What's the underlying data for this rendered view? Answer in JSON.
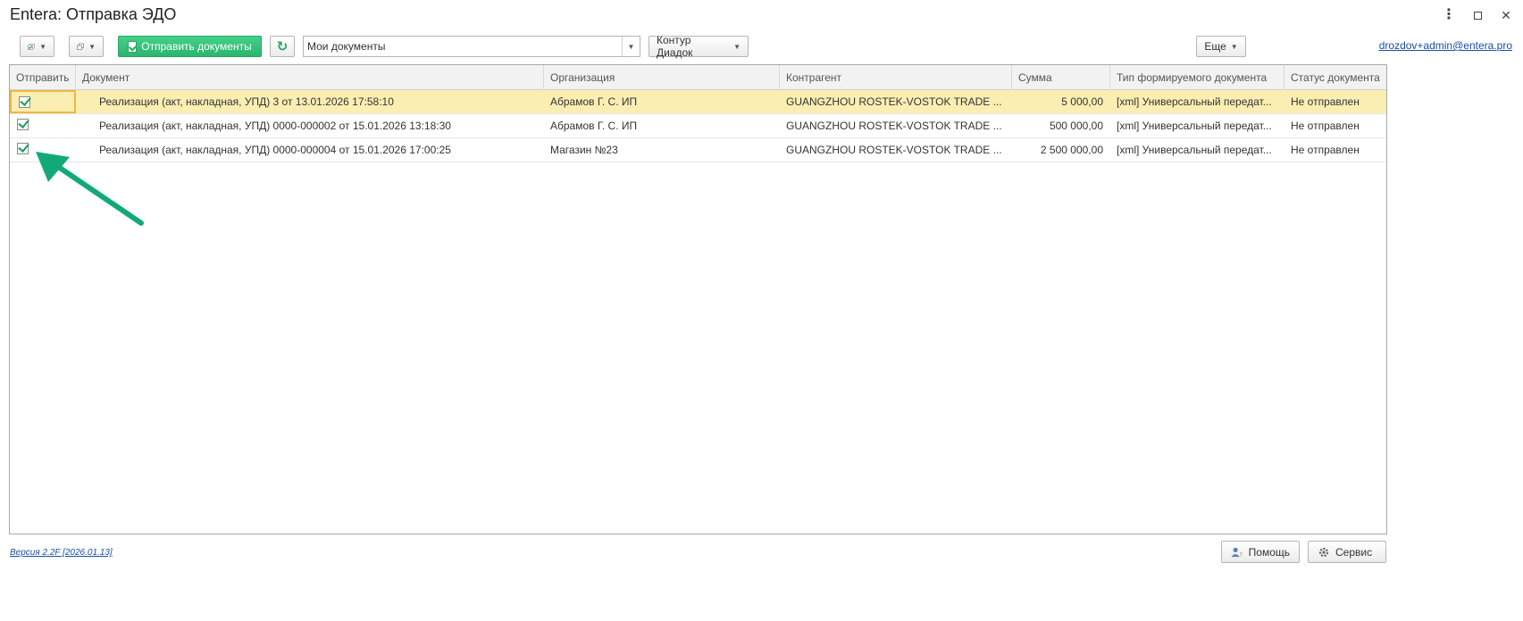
{
  "window": {
    "title": "Entera: Отправка ЭДО"
  },
  "toolbar": {
    "send_label": "Отправить документы",
    "filter_value": "Мои документы",
    "provider_label": "Контур Диадок",
    "more_label": "Еще",
    "user_email": "drozdov+admin@entera.pro"
  },
  "table": {
    "columns": [
      "Отправить",
      "Документ",
      "Организация",
      "Контрагент",
      "Сумма",
      "Тип формируемого документа",
      "Статус документа"
    ],
    "rows": [
      {
        "document": "Реализация (акт, накладная, УПД) 3 от 13.01.2026 17:58:10",
        "organization": "Абрамов Г. С. ИП",
        "counterparty": "GUANGZHOU ROSTEK-VOSTOK TRADE ...",
        "sum": "5 000,00",
        "type": "[xml] Универсальный передат...",
        "status": "Не отправлен"
      },
      {
        "document": "Реализация (акт, накладная, УПД) 0000-000002 от 15.01.2026 13:18:30",
        "organization": "Абрамов Г. С. ИП",
        "counterparty": "GUANGZHOU ROSTEK-VOSTOK TRADE ...",
        "sum": "500 000,00",
        "type": "[xml] Универсальный передат...",
        "status": "Не отправлен"
      },
      {
        "document": "Реализация (акт, накладная, УПД) 0000-000004 от 15.01.2026 17:00:25",
        "organization": "Магазин №23",
        "counterparty": "GUANGZHOU ROSTEK-VOSTOK TRADE ...",
        "sum": "2 500 000,00",
        "type": "[xml] Универсальный передат...",
        "status": "Не отправлен"
      }
    ]
  },
  "footer": {
    "version": "Версия 2.2F [2026.01.13]",
    "help_label": "Помощь",
    "service_label": "Сервис"
  },
  "colors": {
    "accent_green": "#2bb56e",
    "selection": "#fbeeb3",
    "arrow": "#12a97a",
    "link": "#1a4fa6"
  }
}
